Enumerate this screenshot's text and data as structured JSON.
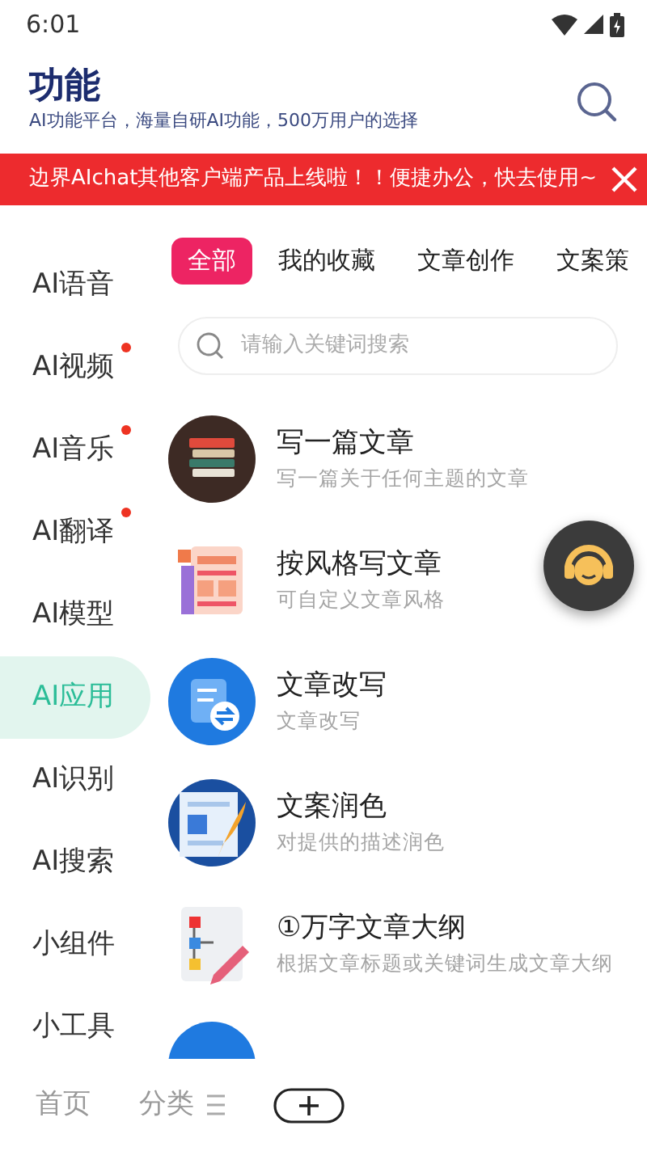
{
  "status_bar": {
    "time": "6:01"
  },
  "header": {
    "title": "功能",
    "subtitle": "AI功能平台，海量自研AI功能，500万用户的选择"
  },
  "banner": {
    "text": "边界AIchat其他客户端产品上线啦！！便捷办公，快去使用~"
  },
  "sidebar": {
    "items": [
      {
        "label": "AI语音",
        "selected": false,
        "new_dot": false
      },
      {
        "label": "AI视频",
        "selected": false,
        "new_dot": true
      },
      {
        "label": "AI音乐",
        "selected": false,
        "new_dot": true
      },
      {
        "label": "AI翻译",
        "selected": false,
        "new_dot": true
      },
      {
        "label": "AI模型",
        "selected": false,
        "new_dot": false
      },
      {
        "label": "AI应用",
        "selected": true,
        "new_dot": false
      },
      {
        "label": "AI识别",
        "selected": false,
        "new_dot": false
      },
      {
        "label": "AI搜索",
        "selected": false,
        "new_dot": false
      },
      {
        "label": "小组件",
        "selected": false,
        "new_dot": false
      },
      {
        "label": "小工具",
        "selected": false,
        "new_dot": false
      }
    ]
  },
  "tabs": [
    {
      "label": "全部",
      "selected": true
    },
    {
      "label": "我的收藏",
      "selected": false
    },
    {
      "label": "文章创作",
      "selected": false
    },
    {
      "label": "文案策",
      "selected": false
    }
  ],
  "search": {
    "placeholder": "请输入关键词搜索"
  },
  "features": [
    {
      "kind": "books",
      "title": "写一篇文章",
      "subtitle": "写一篇关于任何主题的文章"
    },
    {
      "kind": "news",
      "title": "按风格写文章",
      "subtitle": "可自定义文章风格"
    },
    {
      "kind": "swap",
      "title": "文章改写",
      "subtitle": "文章改写"
    },
    {
      "kind": "polish",
      "title": "文案润色",
      "subtitle": "对提供的描述润色"
    },
    {
      "kind": "outline",
      "title": "①万字文章大纲",
      "subtitle": "根据文章标题或关键词生成文章大纲"
    },
    {
      "kind": "blue"
    }
  ],
  "bottom_nav": [
    {
      "label": "首页",
      "kind": "text"
    },
    {
      "label": "分类",
      "kind": "menu"
    },
    {
      "kind": "plus"
    }
  ]
}
